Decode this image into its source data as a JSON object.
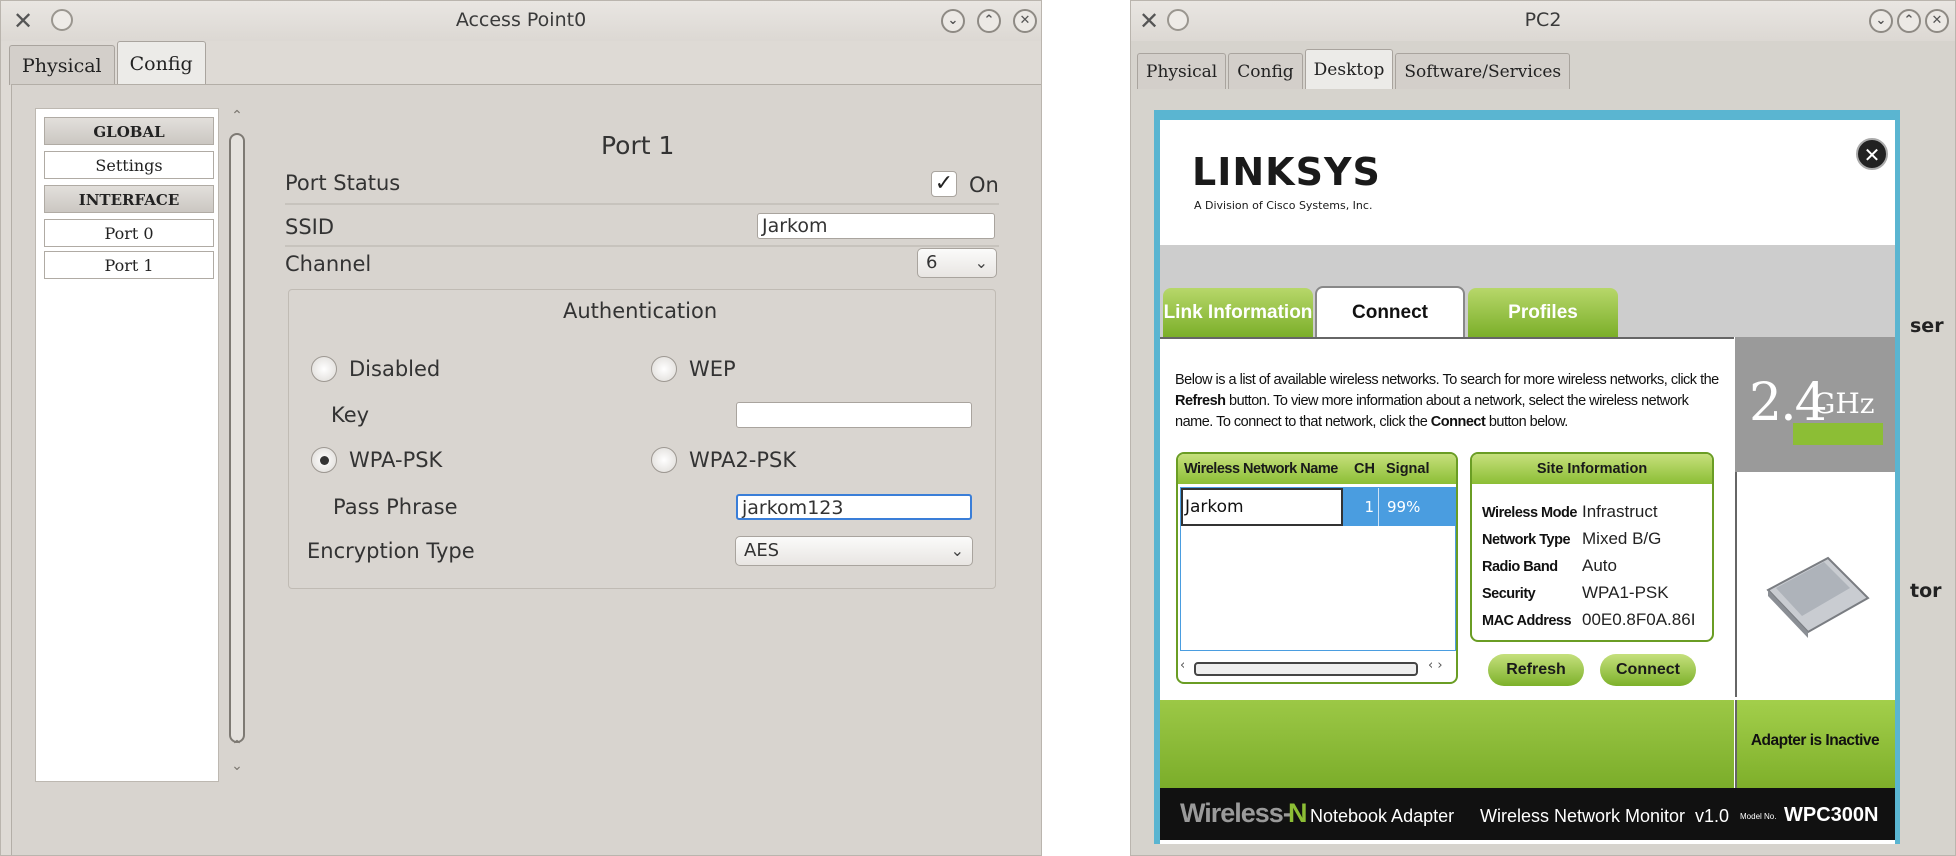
{
  "access_point": {
    "window_title": "Access Point0",
    "tabs": [
      "Physical",
      "Config"
    ],
    "nav": {
      "global_header": "GLOBAL",
      "settings": "Settings",
      "interface_header": "INTERFACE",
      "port0": "Port 0",
      "port1": "Port 1"
    },
    "port_title": "Port 1",
    "port_status_label": "Port Status",
    "port_status_on_label": "On",
    "port_status_checked": true,
    "ssid_label": "SSID",
    "ssid_value": "Jarkom",
    "channel_label": "Channel",
    "channel_value": "6",
    "auth_title": "Authentication",
    "auth_options": {
      "disabled": "Disabled",
      "wep": "WEP",
      "wpa_psk": "WPA-PSK",
      "wpa2_psk": "WPA2-PSK"
    },
    "auth_selected": "WPA-PSK",
    "key_label": "Key",
    "key_value": "",
    "pass_phrase_label": "Pass Phrase",
    "pass_phrase_value": "jarkom123",
    "encryption_label": "Encryption Type",
    "encryption_value": "AES"
  },
  "pc": {
    "window_title": "PC2",
    "tabs": [
      "Physical",
      "Config",
      "Desktop",
      "Software/Services"
    ],
    "active_tab": "Desktop",
    "side_fragments": {
      "top": "ser",
      "bottom": "tor"
    },
    "linksys": {
      "brand": "LINKSYS",
      "brand_sub": "A Division of Cisco Systems, Inc.",
      "tabs": [
        "Link Information",
        "Connect",
        "Profiles"
      ],
      "active_tab": "Connect",
      "description_parts": [
        "Below is a list of available wireless networks. To search for more wireless networks, click the ",
        "Refresh",
        " button. To view more information about a network, select the wireless network name. To connect to that network, click the ",
        "Connect",
        " button below."
      ],
      "network_table": {
        "headers": [
          "Wireless Network Name",
          "CH",
          "Signal"
        ],
        "rows": [
          {
            "name": "Jarkom",
            "ch": "1",
            "signal": "99%"
          }
        ]
      },
      "site_info": {
        "title": "Site Information",
        "rows": [
          {
            "key": "Wireless Mode",
            "value": "Infrastruct"
          },
          {
            "key": "Network Type",
            "value": "Mixed B/G"
          },
          {
            "key": "Radio Band",
            "value": "Auto"
          },
          {
            "key": "Security",
            "value": "WPA1-PSK"
          },
          {
            "key": "MAC Address",
            "value": "00E0.8F0A.86I"
          }
        ]
      },
      "refresh_button": "Refresh",
      "connect_button": "Connect",
      "band": "2.4",
      "band_unit": "GHz",
      "adapter_status": "Adapter is Inactive",
      "footer": {
        "wireless": "Wireless-",
        "n": "N",
        "adapter": "Notebook Adapter",
        "monitor": "Wireless Network Monitor  v1.0",
        "model_label": "Model No.",
        "model": "WPC300N"
      }
    }
  },
  "colors": {
    "linksys_green": "#8cbe35",
    "linksys_blue_frame": "#5ab5d1",
    "selection_blue": "#4a9de0"
  }
}
